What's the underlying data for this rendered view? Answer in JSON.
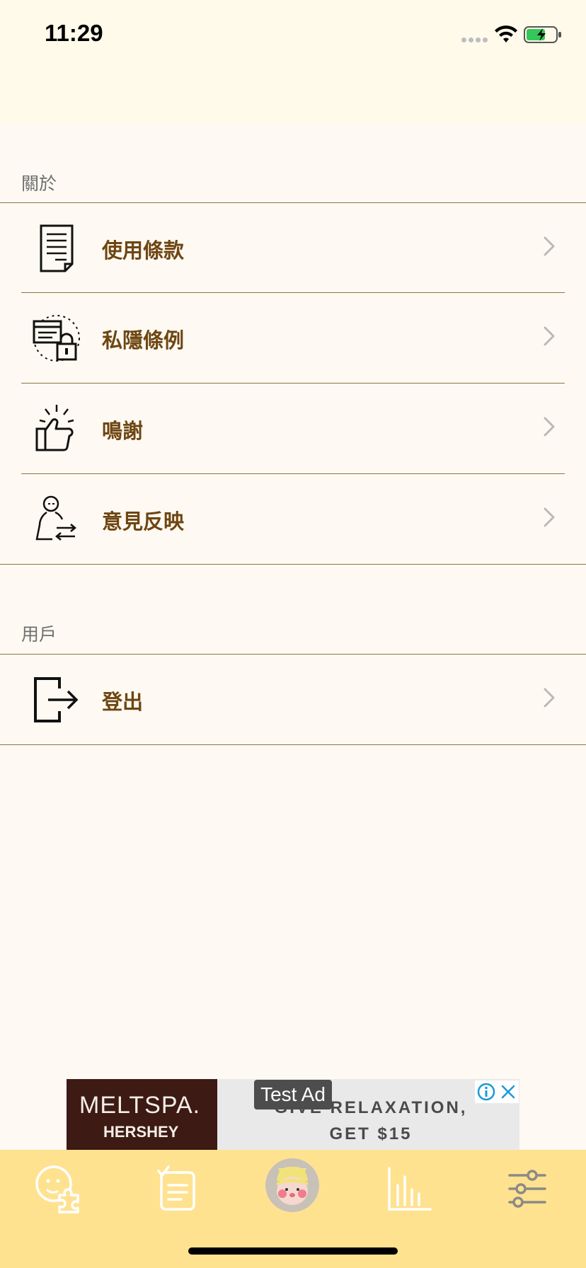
{
  "status_bar": {
    "time": "11:29"
  },
  "sections": [
    {
      "header": "關於",
      "items": [
        {
          "label": "使用條款",
          "icon": "document-icon"
        },
        {
          "label": "私隱條例",
          "icon": "privacy-lock-icon"
        },
        {
          "label": "鳴謝",
          "icon": "thumbs-up-icon"
        },
        {
          "label": "意見反映",
          "icon": "feedback-person-icon"
        }
      ]
    },
    {
      "header": "用戶",
      "items": [
        {
          "label": "登出",
          "icon": "logout-icon"
        }
      ]
    }
  ],
  "ad": {
    "label": "Test Ad",
    "brand": "MELTSPA.",
    "brand_sub": "HERSHEY",
    "copy_line1": "GIVE RELAXATION,",
    "copy_line2": "GET $15"
  },
  "tab_bar": {
    "tabs": [
      "puzzle-face-icon",
      "checklist-icon",
      "avatar",
      "bar-chart-icon",
      "sliders-icon"
    ]
  },
  "colors": {
    "background": "#fefaf3",
    "header_bg": "#fffaea",
    "label": "#6e4612",
    "divider": "#8a7440",
    "tab_bar": "#ffe290"
  }
}
